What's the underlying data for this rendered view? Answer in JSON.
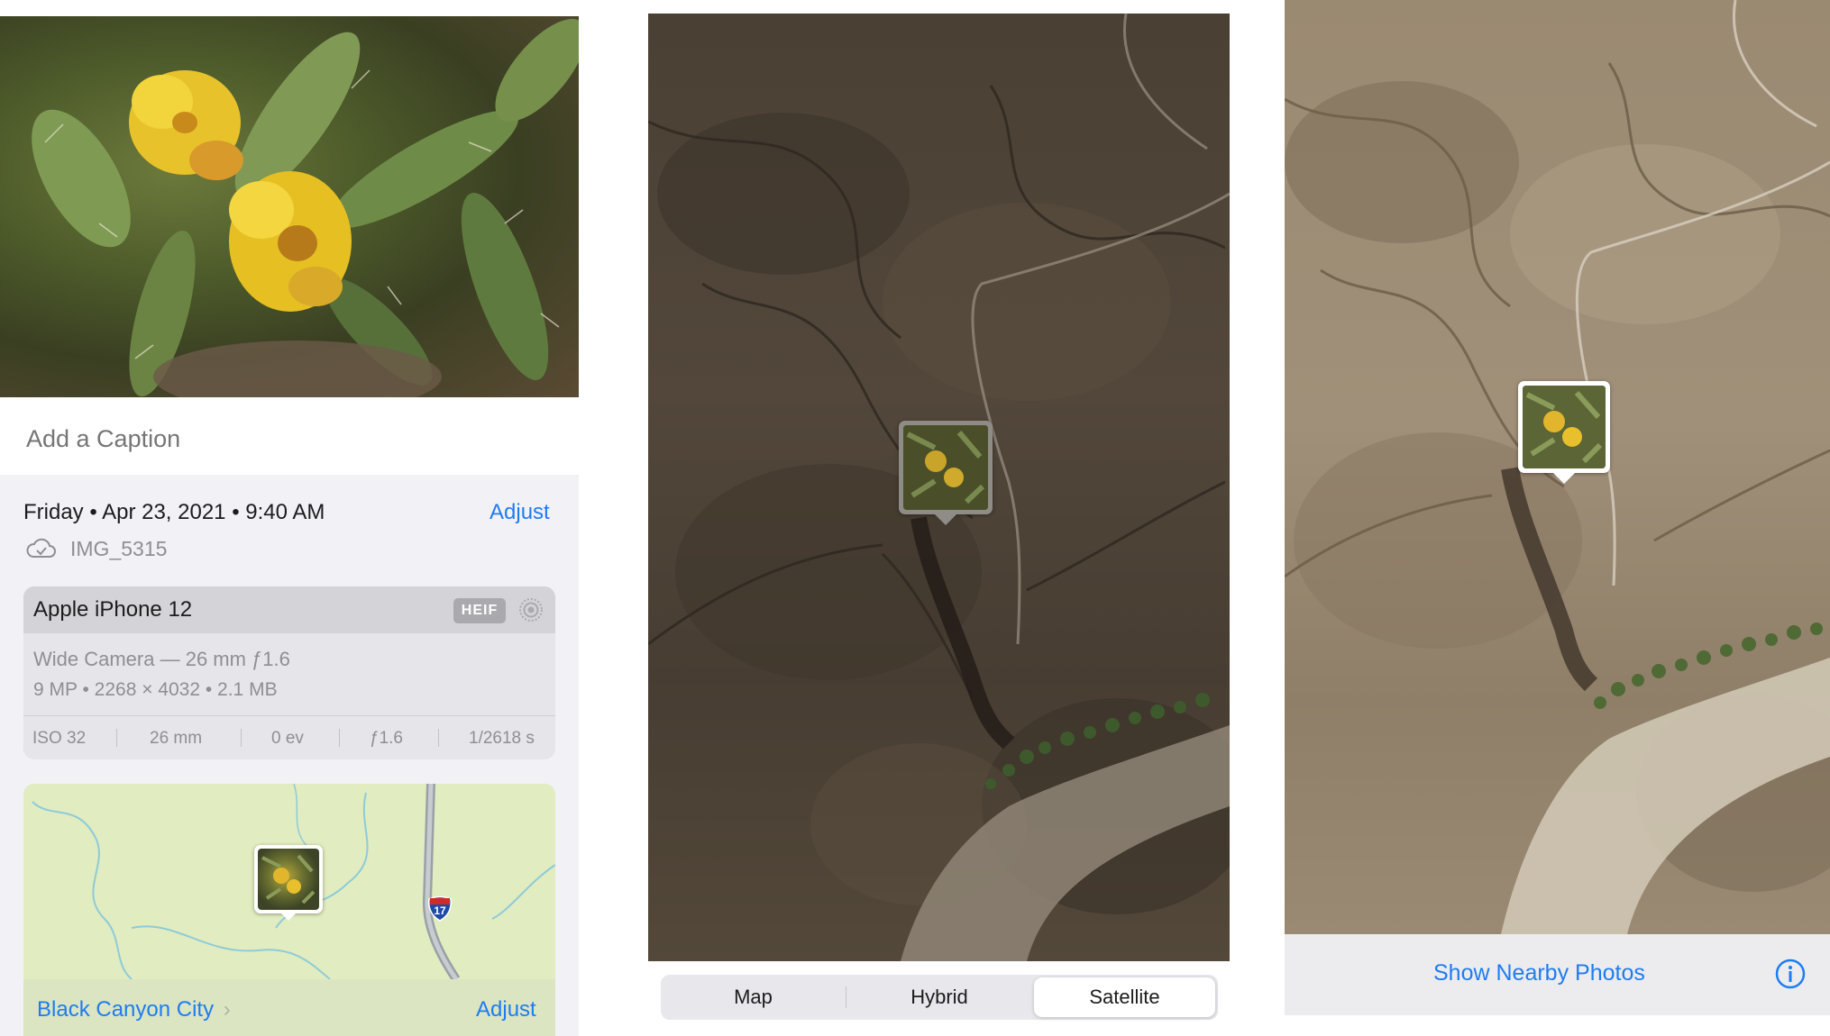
{
  "info_panel": {
    "caption_placeholder": "Add a Caption",
    "date": "Friday • Apr 23, 2021 • 9:40 AM",
    "date_adjust_label": "Adjust",
    "cloud_icon": "cloud-check-icon",
    "filename": "IMG_5315",
    "camera": {
      "name": "Apple iPhone 12",
      "format_badge": "HEIF",
      "live_icon": "live-photo-icon",
      "lens": "Wide Camera — 26 mm ƒ1.6",
      "specs": "9 MP  •  2268 × 4032  •  2.1 MB",
      "exif": {
        "iso": "ISO 32",
        "focal_length": "26 mm",
        "exposure": "0 ev",
        "aperture": "ƒ1.6",
        "shutter": "1/2618 s"
      }
    },
    "map": {
      "place": "Black Canyon City",
      "place_chevron": "›",
      "adjust_label": "Adjust",
      "highway_shield": "17"
    }
  },
  "map_type_control": {
    "options": [
      "Map",
      "Hybrid",
      "Satellite"
    ],
    "selected": "Satellite"
  },
  "nearby": {
    "label": "Show Nearby Photos",
    "info_icon": "info-circle-icon"
  },
  "colors": {
    "accent": "#1e7cf2",
    "info_background": "#f2f2f6",
    "map_land": "#e1ecc0",
    "satellite_dark": "#4a4034",
    "satellite_light": "#9b8a72"
  }
}
